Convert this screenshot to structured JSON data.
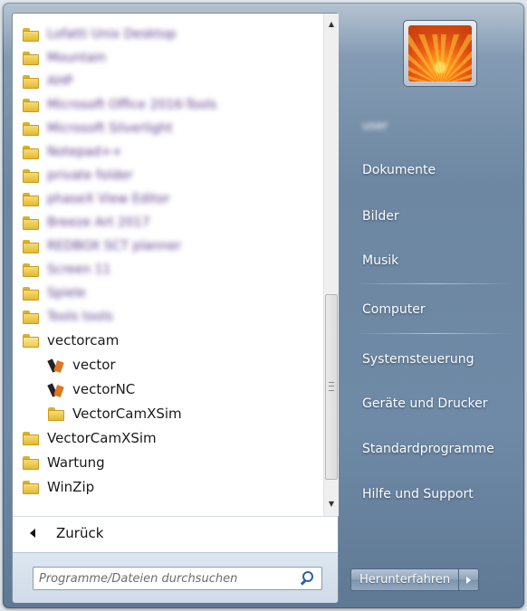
{
  "programs": {
    "blurred_items": [
      "Lofatti Unix Desktop",
      "Mountain",
      "AHP",
      "Microsoft Office 2016-Tools",
      "Microsoft Silverlight",
      "Notepad++",
      "private folder",
      "phaseX View Editor",
      "Breeze Art 2017",
      "REDBOX SCT planner",
      "Screen 11",
      "Spiele",
      "Tools tools"
    ],
    "vectorcam_folder": "vectorcam",
    "vectorcam_children": [
      "vector",
      "vectorNC",
      "VectorCamXSim"
    ],
    "after_items": [
      "VectorCamXSim",
      "Wartung",
      "WinZip"
    ]
  },
  "back_label": "Zurück",
  "search": {
    "placeholder": "Programme/Dateien durchsuchen"
  },
  "user": {
    "name": "user"
  },
  "right_items": [
    "Dokumente",
    "Bilder",
    "Musik",
    "Computer",
    "Systemsteuerung",
    "Geräte und Drucker",
    "Standardprogramme",
    "Hilfe und Support"
  ],
  "shutdown_label": "Herunterfahren",
  "icons": {
    "folder": "folder-icon",
    "app": "vectorcam-app-icon",
    "search": "search-icon",
    "back": "back-arrow-icon",
    "shutdown_options": "arrow-right-icon"
  }
}
